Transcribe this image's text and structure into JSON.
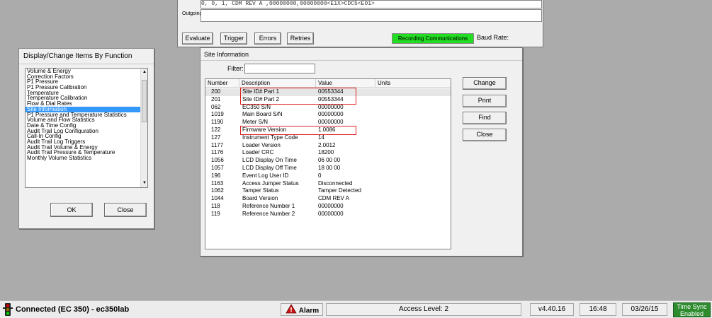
{
  "comm_panel": {
    "incoming_text": "        0,          0,          1, CDM REV A ,00000000,00000000<E1X>CDC5<E01>",
    "outgoing_label": "Outgoing",
    "buttons": [
      "Evaluate",
      "Trigger",
      "Errors",
      "Retries"
    ],
    "recording_label": "Recording Communications",
    "recording_color": "#22dd22",
    "baud_label": "Baud Rate:"
  },
  "function_dialog": {
    "title": "Display/Change Items By Function",
    "items": [
      "Volume & Energy",
      "Correction Factors",
      "P1 Pressure",
      "P1 Pressure Calibration",
      "Temperature",
      "Temperature Calibration",
      "Flow & Dial Rates",
      "Site Information",
      "P1 Pressure and Temperature Statistics",
      "Volume and Flow Statistics",
      "Date & Time Config",
      "Audit Trail Log Configuration",
      "Call-In Config",
      "Audit Trail Log Triggers",
      "Audit Trail Volume & Energy",
      "Audit Trail Pressure & Temperature",
      "Monthly Volume Statistics"
    ],
    "selected_item": "Site Information",
    "ok_label": "OK",
    "close_label": "Close"
  },
  "site_dialog": {
    "title": "Site Information",
    "filter_label": "Filter:",
    "filter_value": "",
    "columns": [
      "Number",
      "Description",
      "Value",
      "Units"
    ],
    "rows": [
      [
        "200",
        "Site ID# Part 1",
        "00553344",
        ""
      ],
      [
        "201",
        "Site ID# Part 2",
        "00553344",
        ""
      ],
      [
        "062",
        "EC350 S/N",
        "00000000",
        ""
      ],
      [
        "1019",
        "Main Board S/N",
        "00000000",
        ""
      ],
      [
        "1190",
        "Meter S/N",
        "00000000",
        ""
      ],
      [
        "122",
        "Firmware Version",
        "1.0086",
        ""
      ],
      [
        "127",
        "Instrument Type Code",
        "14",
        ""
      ],
      [
        "1177",
        "Loader Version",
        "2.0012",
        ""
      ],
      [
        "1176",
        "Loader CRC",
        "18200",
        ""
      ],
      [
        "1056",
        "LCD Display On Time",
        "06 00 00",
        ""
      ],
      [
        "1057",
        "LCD Display Off Time",
        "18 00 00",
        ""
      ],
      [
        "196",
        "Event Log User ID",
        "0",
        ""
      ],
      [
        "1163",
        "Access Jumper Status",
        "Disconnected",
        ""
      ],
      [
        "1062",
        "Tamper Status",
        "Tamper Detected",
        ""
      ],
      [
        "1044",
        "Board Version",
        "CDM REV A",
        ""
      ],
      [
        "118",
        "Reference Number 1",
        "00000000",
        ""
      ],
      [
        "119",
        "Reference Number 2",
        "00000000",
        ""
      ]
    ],
    "highlight_color": "#dd2222",
    "buttons": [
      "Change",
      "Print",
      "Find",
      "Close"
    ]
  },
  "status_bar": {
    "connection": "Connected (EC 350) - ec350lab",
    "alarm": "Alarm",
    "access_level": "Access Level: 2",
    "version": "v4.40.16",
    "time": "16:48",
    "date": "03/26/15",
    "time_sync_line1": "Time Sync",
    "time_sync_line2": "Enabled",
    "time_sync_color": "#2e8b2e"
  }
}
